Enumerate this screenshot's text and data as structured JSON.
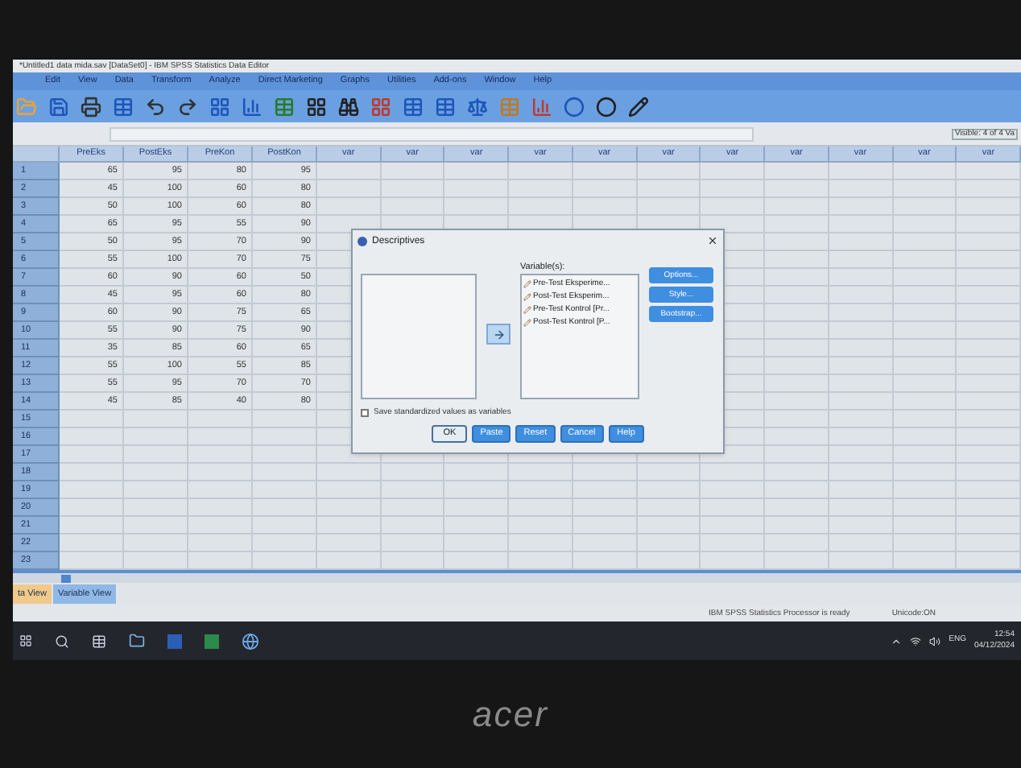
{
  "window": {
    "title": "*Untitled1 data mida.sav [DataSet0] - IBM SPSS Statistics Data Editor"
  },
  "menu": [
    "Edit",
    "View",
    "Data",
    "Transform",
    "Analyze",
    "Direct Marketing",
    "Graphs",
    "Utilities",
    "Add-ons",
    "Window",
    "Help"
  ],
  "cell_editor": {
    "visible_count": "Visible: 4 of 4 Va"
  },
  "grid": {
    "columns": [
      "PreEks",
      "PostEks",
      "PreKon",
      "PostKon",
      "var",
      "var",
      "var",
      "var",
      "var",
      "var",
      "var",
      "var",
      "var",
      "var",
      "var"
    ],
    "rows": [
      {
        "number": "1",
        "cells": [
          "65",
          "95",
          "80",
          "95"
        ]
      },
      {
        "number": "2",
        "cells": [
          "45",
          "100",
          "60",
          "80"
        ]
      },
      {
        "number": "3",
        "cells": [
          "50",
          "100",
          "60",
          "80"
        ]
      },
      {
        "number": "4",
        "cells": [
          "65",
          "95",
          "55",
          "90"
        ]
      },
      {
        "number": "5",
        "cells": [
          "50",
          "95",
          "70",
          "90"
        ]
      },
      {
        "number": "6",
        "cells": [
          "55",
          "100",
          "70",
          "75"
        ]
      },
      {
        "number": "7",
        "cells": [
          "60",
          "90",
          "60",
          "50"
        ]
      },
      {
        "number": "8",
        "cells": [
          "45",
          "95",
          "60",
          "80"
        ]
      },
      {
        "number": "9",
        "cells": [
          "60",
          "90",
          "75",
          "65"
        ]
      },
      {
        "number": "10",
        "cells": [
          "55",
          "90",
          "75",
          "90"
        ]
      },
      {
        "number": "11",
        "cells": [
          "35",
          "85",
          "60",
          "65"
        ]
      },
      {
        "number": "12",
        "cells": [
          "55",
          "100",
          "55",
          "85"
        ]
      },
      {
        "number": "13",
        "cells": [
          "55",
          "95",
          "70",
          "70"
        ]
      },
      {
        "number": "14",
        "cells": [
          "45",
          "85",
          "40",
          "80"
        ]
      },
      {
        "number": "15",
        "cells": []
      },
      {
        "number": "16",
        "cells": []
      },
      {
        "number": "17",
        "cells": []
      },
      {
        "number": "18",
        "cells": []
      },
      {
        "number": "19",
        "cells": []
      },
      {
        "number": "20",
        "cells": []
      },
      {
        "number": "21",
        "cells": []
      },
      {
        "number": "22",
        "cells": []
      },
      {
        "number": "23",
        "cells": []
      }
    ]
  },
  "dialog": {
    "title": "Descriptives",
    "variables_label": "Variable(s):",
    "variables": [
      "Pre-Test Eksperime...",
      "Post-Test Eksperim...",
      "Pre-Test Kontrol [Pr...",
      "Post-Test Kontrol [P..."
    ],
    "side_buttons": [
      "Options...",
      "Style...",
      "Bootstrap..."
    ],
    "checkbox": {
      "label": "Save standardized values as variables",
      "checked": false
    },
    "buttons": [
      {
        "label": "OK",
        "focused": true
      },
      {
        "label": "Paste",
        "focused": false
      },
      {
        "label": "Reset",
        "focused": false
      },
      {
        "label": "Cancel",
        "focused": false
      },
      {
        "label": "Help",
        "focused": false
      }
    ]
  },
  "view_tabs": [
    {
      "label": "ta View",
      "selected": true
    },
    {
      "label": "Variable View",
      "selected": false
    }
  ],
  "status_bar": {
    "message": "IBM SPSS Statistics Processor is ready",
    "encoding": "Unicode:ON"
  },
  "taskbar": {
    "language": "ENG",
    "time": "12:54",
    "date": "04/12/2024"
  },
  "bezel": {
    "logo": "acer"
  }
}
